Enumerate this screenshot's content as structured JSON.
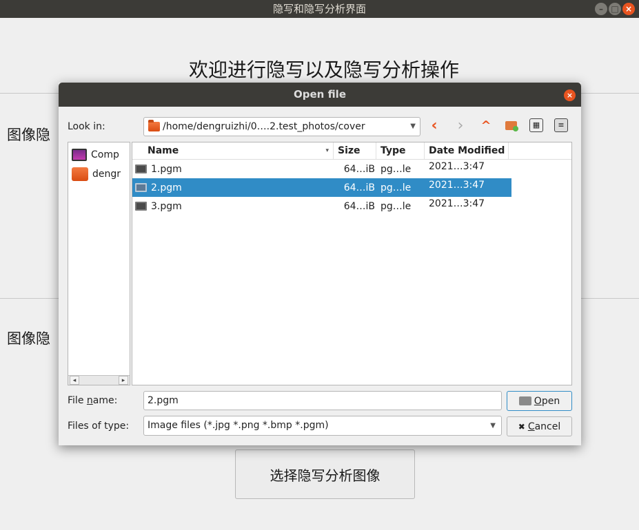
{
  "main_window": {
    "title": "隐写和隐写分析界面",
    "controls": [
      "–",
      "□",
      "×"
    ],
    "heading": "欢迎进行隐写以及隐写分析操作",
    "section1_label": "图像隐",
    "section2_label": "图像隐",
    "select_analysis_button": "选择隐写分析图像"
  },
  "dialog": {
    "title": "Open file",
    "close_symbol": "×",
    "look_in_label": "Look in:",
    "path": "/home/dengruizhi/0….2.test_photos/cover",
    "nav": {
      "back": "‹",
      "forward": "›",
      "up": "^",
      "detail_view": "≡",
      "list_view": "▦"
    },
    "sidebar": {
      "items": [
        {
          "label": "Comp",
          "icon": "computer-icon"
        },
        {
          "label": "dengr",
          "icon": "folder-icon"
        }
      ],
      "scroll_left": "◂",
      "scroll_right": "▸"
    },
    "columns": {
      "name": "Name",
      "size": "Size",
      "type": "Type",
      "date": "Date Modified",
      "sort": "▾"
    },
    "files": [
      {
        "name": "1.pgm",
        "size": "64…iB",
        "type": "pg…le",
        "date": "2021…3:47"
      },
      {
        "name": "2.pgm",
        "size": "64…iB",
        "type": "pg…le",
        "date": "2021…3:47"
      },
      {
        "name": "3.pgm",
        "size": "64…iB",
        "type": "pg…le",
        "date": "2021…3:47"
      }
    ],
    "selected_file": "2.pgm",
    "file_name_label_pre": "File ",
    "file_name_label_u": "n",
    "file_name_label_post": "ame:",
    "file_name_value": "2.pgm",
    "files_of_type_label": "Files of type:",
    "files_of_type_value": "Image files (*.jpg *.png *.bmp *.pgm)",
    "open_u": "O",
    "open_rest": "pen",
    "cancel_icon": "✖",
    "cancel_u": "C",
    "cancel_rest": "ancel"
  }
}
